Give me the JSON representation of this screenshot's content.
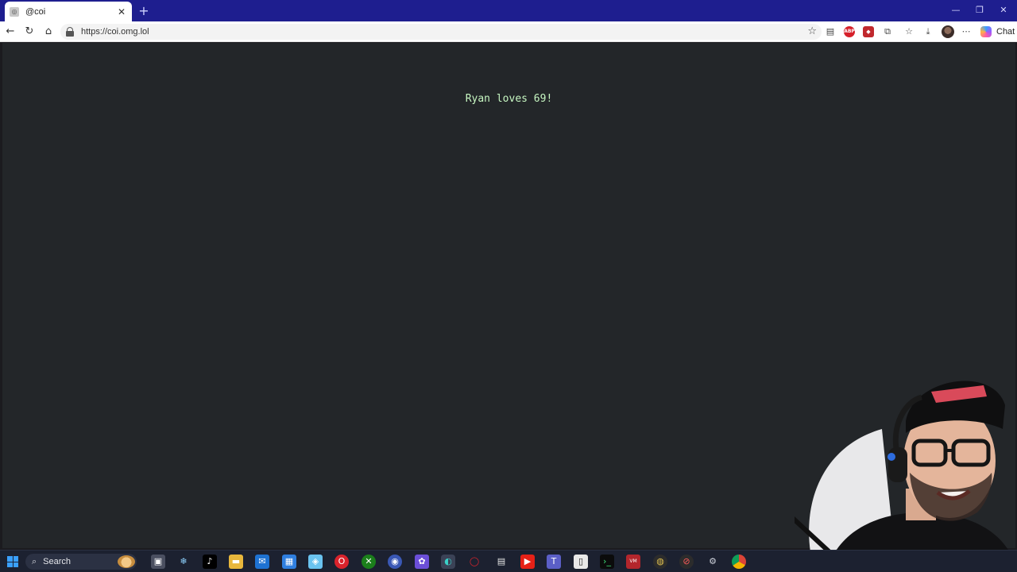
{
  "browser": {
    "tab": {
      "title": "@coi",
      "favicon": "page-favicon-icon",
      "close_glyph": "✕"
    },
    "new_tab_glyph": "+",
    "window_controls": {
      "minimize": "—",
      "restore": "❐",
      "close": "✕"
    },
    "toolbar": {
      "back_glyph": "←",
      "refresh_glyph": "↻",
      "home_glyph": "⌂",
      "url": "https://coi.omg.lol",
      "favorite_glyph": "☆",
      "chat_label": "Chat",
      "more_glyph": "⋯"
    }
  },
  "page": {
    "message": "Ryan loves 69!",
    "background_color": "#232629",
    "text_color": "#c7f7c2"
  },
  "taskbar": {
    "search_label": "Search",
    "search_glyph": "🔍"
  },
  "colors": {
    "titlebar": "#1e1e8f",
    "taskbar": "#1c2130",
    "accent": "#3aa0ff"
  }
}
